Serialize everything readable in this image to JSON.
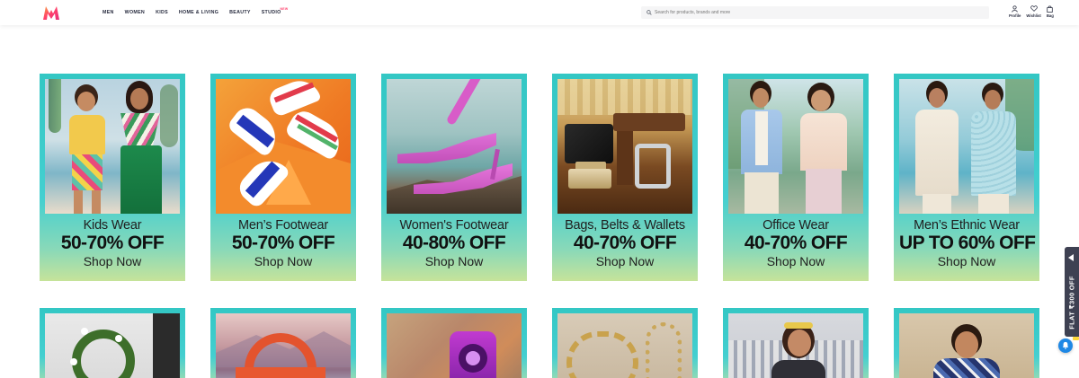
{
  "header": {
    "nav": [
      {
        "label": "MEN"
      },
      {
        "label": "WOMEN"
      },
      {
        "label": "KIDS"
      },
      {
        "label": "HOME & LIVING"
      },
      {
        "label": "BEAUTY"
      },
      {
        "label": "STUDIO",
        "badge": "NEW"
      }
    ],
    "search": {
      "placeholder": "Search for products, brands and more"
    },
    "actions": [
      {
        "label": "Profile",
        "icon": "profile-icon"
      },
      {
        "label": "Wishlist",
        "icon": "heart-icon"
      },
      {
        "label": "Bag",
        "icon": "bag-icon"
      }
    ]
  },
  "colors": {
    "brand": "#ff3f6c",
    "tile_teal": "#33c7c4",
    "tile_lime": "#c6e39a",
    "side_tab": "#3e4152",
    "notify": "#1e88e5"
  },
  "tiles": [
    {
      "title": "Kids Wear",
      "discount": "50-70% OFF",
      "cta": "Shop Now"
    },
    {
      "title": "Men’s Footwear",
      "discount": "50-70% OFF",
      "cta": "Shop Now"
    },
    {
      "title": "Women's Footwear",
      "discount": "40-80% OFF",
      "cta": "Shop Now"
    },
    {
      "title": "Bags, Belts & Wallets",
      "discount": "40-70% OFF",
      "cta": "Shop Now"
    },
    {
      "title": "Office Wear",
      "discount": "40-70% OFF",
      "cta": "Shop Now"
    },
    {
      "title": "Men’s Ethnic Wear",
      "discount": "UP TO 60% OFF",
      "cta": "Shop Now"
    }
  ],
  "side_tab": {
    "label": "FLAT ₹300 OFF"
  }
}
